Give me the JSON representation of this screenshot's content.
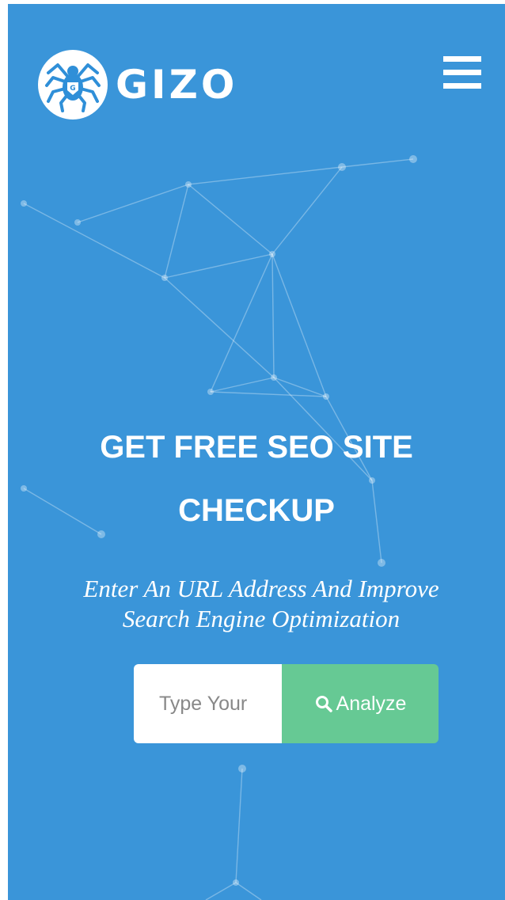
{
  "header": {
    "brand_name": "GIZO",
    "logo_icon": "spider-icon",
    "menu_icon": "hamburger-menu-icon"
  },
  "hero": {
    "headline_line1": "GET FREE SEO SITE",
    "headline_line2": "CHECKUP",
    "subtitle_line1": "Enter An URL Address And Improve",
    "subtitle_line2": "Search Engine Optimization"
  },
  "search": {
    "input_value": "",
    "input_placeholder": "Type Your",
    "button_label": "Analyze",
    "button_icon": "search-icon"
  },
  "colors": {
    "background": "#3a95d9",
    "button": "#66c994",
    "text": "#ffffff",
    "logo_blue": "#2f8fd8"
  }
}
